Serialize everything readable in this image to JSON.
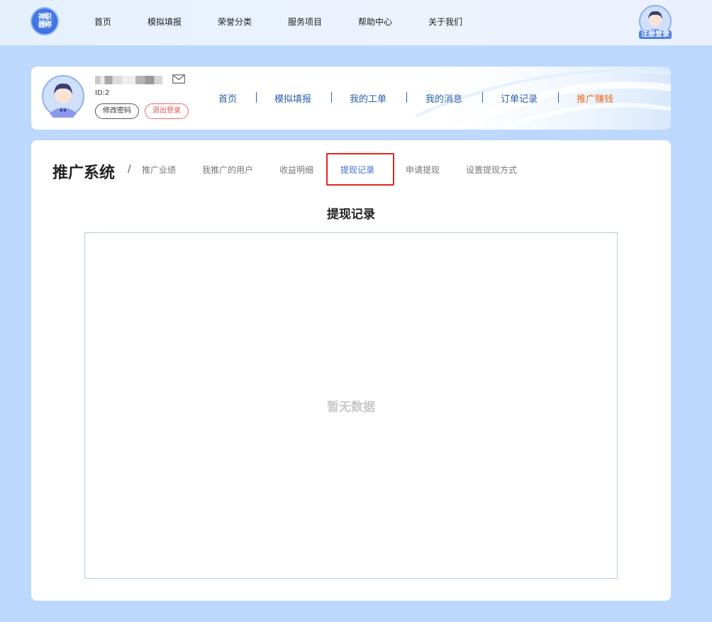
{
  "topnav": {
    "logo_text": "神职器称",
    "items": [
      "首页",
      "模拟填报",
      "荣誉分类",
      "服务项目",
      "帮助中心",
      "关于我们"
    ],
    "login_label": "注册登录"
  },
  "user": {
    "id_label": "ID:2",
    "change_password": "修改密码",
    "logout": "退出登录"
  },
  "subnav": {
    "items": [
      "首页",
      "模拟填报",
      "我的工单",
      "我的消息",
      "订单记录",
      "推广赚钱"
    ],
    "active_color": "#f06a1a"
  },
  "panel": {
    "title": "推广系统",
    "separator": "/",
    "tabs": [
      "推广业绩",
      "我推广的用户",
      "收益明细",
      "提现记录",
      "申请提现",
      "设置提现方式"
    ],
    "active_tab": "提现记录",
    "section_title": "提现记录",
    "empty_text": "暂无数据"
  },
  "colors": {
    "page_bg": "#bcd8fc",
    "highlight_border": "#e0261f",
    "link": "#2a5fa8"
  }
}
